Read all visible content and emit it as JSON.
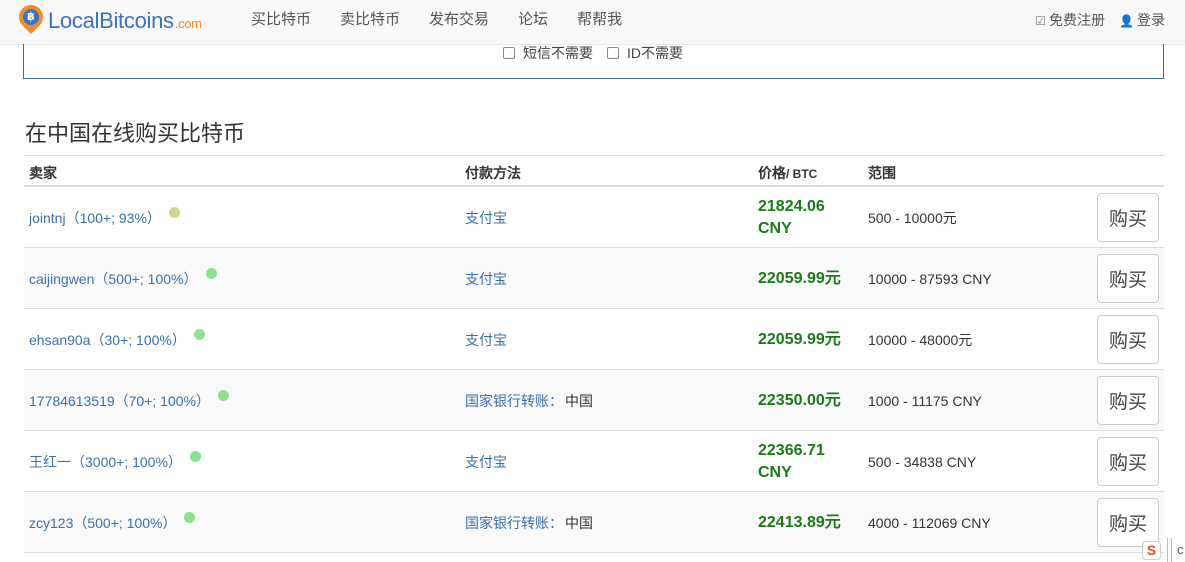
{
  "navbar": {
    "brand_name": "LocalBitcoins",
    "brand_suffix": ".com",
    "links": [
      "买比特币",
      "卖比特币",
      "发布交易",
      "论坛",
      "帮帮我"
    ],
    "register_label": "免费注册",
    "login_label": "登录"
  },
  "filters": {
    "sms_label": "短信不需要",
    "id_label": "ID不需要"
  },
  "section_title": "在中国在线购买比特币",
  "table": {
    "headers": {
      "seller": "卖家",
      "payment": "付款方法",
      "price": "价格",
      "price_unit": "/ BTC",
      "range": "范围"
    },
    "rows": [
      {
        "seller": "jointnj（100+; 93%）",
        "status_color": "#d6d68a",
        "payment": "支付宝",
        "country": "",
        "price": "21824.06 CNY",
        "range": "500 - 10000元",
        "buy": "购买"
      },
      {
        "seller": "caijingwen（500+; 100%）",
        "status_color": "#8de08d",
        "payment": "支付宝",
        "country": "",
        "price": "22059.99元",
        "range": "10000 - 87593 CNY",
        "buy": "购买"
      },
      {
        "seller": "ehsan90a（30+; 100%）",
        "status_color": "#8de08d",
        "payment": "支付宝",
        "country": "",
        "price": "22059.99元",
        "range": "10000 - 48000元",
        "buy": "购买"
      },
      {
        "seller": "17784613519（70+; 100%）",
        "status_color": "#8de08d",
        "payment": "国家银行转账：",
        "country": "中国",
        "price": "22350.00元",
        "range": "1000 - 11175 CNY",
        "buy": "购买"
      },
      {
        "seller": "王红一（3000+; 100%）",
        "status_color": "#8de08d",
        "payment": "支付宝",
        "country": "",
        "price": "22366.71 CNY",
        "range": "500 - 34838 CNY",
        "buy": "购买"
      },
      {
        "seller": "zcy123（500+; 100%）",
        "status_color": "#8de08d",
        "payment": "国家银行转账：",
        "country": "中国",
        "price": "22413.89元",
        "range": "4000 - 112069 CNY",
        "buy": "购买"
      }
    ]
  },
  "corner_widget": {
    "icon_letter": "S",
    "trailing_char": "c"
  }
}
